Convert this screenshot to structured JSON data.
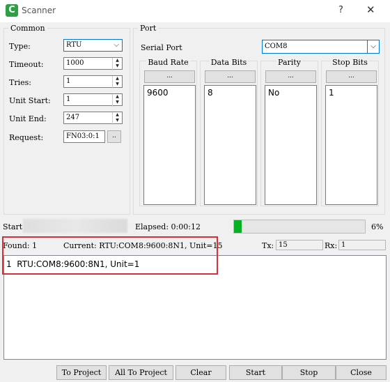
{
  "window": {
    "title": "Scanner",
    "icon_letter": "C",
    "help_glyph": "?",
    "close_glyph": "✕"
  },
  "common": {
    "legend": "Common",
    "type": {
      "label": "Type:",
      "value": "RTU"
    },
    "timeout": {
      "label": "Timeout:",
      "value": "1000"
    },
    "tries": {
      "label": "Tries:",
      "value": "1"
    },
    "unit_start": {
      "label": "Unit Start:",
      "value": "1"
    },
    "unit_end": {
      "label": "Unit End:",
      "value": "247"
    },
    "request": {
      "label": "Request:",
      "value": "FN03:0:1",
      "browse": ".."
    }
  },
  "port": {
    "legend": "Port",
    "serial_label": "Serial Port",
    "serial_value": "COM8",
    "columns": [
      {
        "header": "Baud Rate",
        "button": "...",
        "items": [
          "9600"
        ]
      },
      {
        "header": "Data Bits",
        "button": "...",
        "items": [
          "8"
        ]
      },
      {
        "header": "Parity",
        "button": "...",
        "items": [
          "No"
        ]
      },
      {
        "header": "Stop Bits",
        "button": "...",
        "items": [
          "1"
        ]
      }
    ]
  },
  "status": {
    "start_label": "Start",
    "elapsed": "Elapsed: 0:00:12",
    "progress_percent": 6,
    "progress_text": "6%",
    "found": "Found: 1",
    "current": "Current: RTU:COM8:9600:8N1, Unit=15",
    "tx_label": "Tx:",
    "tx_value": "15",
    "rx_label": "Rx:",
    "rx_value": "1"
  },
  "results": [
    {
      "index": "1",
      "text": "RTU:COM8:9600:8N1, Unit=1"
    }
  ],
  "buttons": {
    "to_project": "To Project",
    "all_to_project": "All To Project",
    "clear": "Clear",
    "start": "Start",
    "stop": "Stop",
    "close": "Close"
  },
  "colors": {
    "highlight": "#d3303a",
    "progress": "#06b025",
    "icon": "#2ea043"
  }
}
